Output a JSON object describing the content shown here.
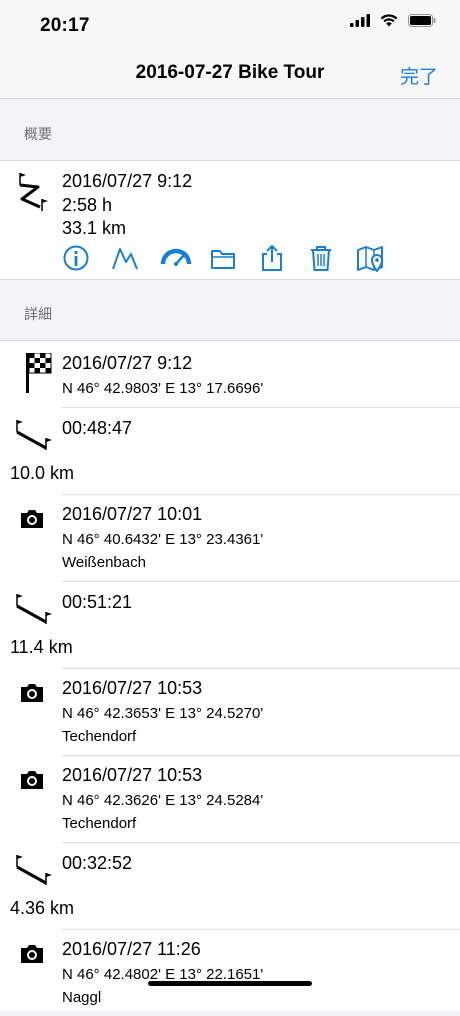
{
  "status": {
    "time": "20:17"
  },
  "nav": {
    "title": "2016-07-27 Bike Tour",
    "done": "完了"
  },
  "summary": {
    "header": "概要",
    "date": "2016/07/27 9:12",
    "duration": "2:58 h",
    "distance": "33.1 km",
    "actions": [
      "info-icon",
      "elevation-icon",
      "speedometer-icon",
      "folder-icon",
      "share-icon",
      "trash-icon",
      "map-icon"
    ]
  },
  "details": {
    "header": "詳細",
    "items": [
      {
        "type": "start",
        "line1": "2016/07/27 9:12",
        "line2": "N 46° 42.9803' E 13° 17.6696'"
      },
      {
        "type": "segment",
        "time": "00:48:47",
        "distance": "10.0 km"
      },
      {
        "type": "photo",
        "line1": "2016/07/27 10:01",
        "line2": "N 46° 40.6432' E 13° 23.4361'",
        "line3": "Weißenbach"
      },
      {
        "type": "segment",
        "time": "00:51:21",
        "distance": "11.4 km"
      },
      {
        "type": "photo",
        "line1": "2016/07/27 10:53",
        "line2": "N 46° 42.3653' E 13° 24.5270'",
        "line3": "Techendorf"
      },
      {
        "type": "photo",
        "line1": "2016/07/27 10:53",
        "line2": "N 46° 42.3626' E 13° 24.5284'",
        "line3": "Techendorf"
      },
      {
        "type": "segment",
        "time": "00:32:52",
        "distance": "4.36 km"
      },
      {
        "type": "photo",
        "line1": "2016/07/27 11:26",
        "line2": "N 46° 42.4802' E 13° 22.1651'",
        "line3": "Naggl"
      }
    ]
  },
  "colors": {
    "accent": "#1a7fd4"
  }
}
